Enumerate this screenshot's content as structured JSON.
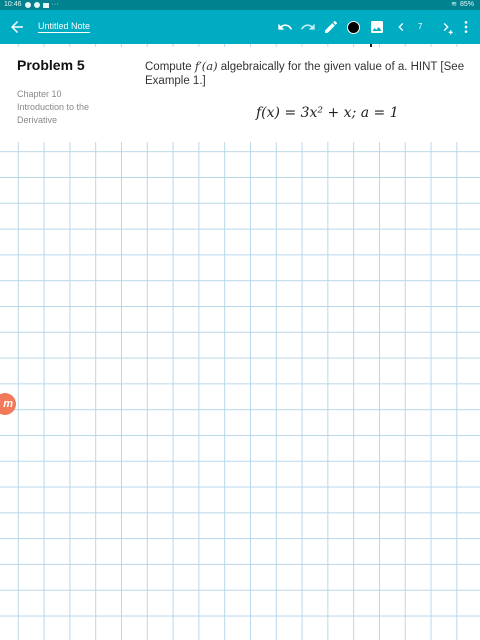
{
  "status": {
    "time": "10:46",
    "battery": "85%"
  },
  "appbar": {
    "note_title": "Untitled Note",
    "page_number": "7"
  },
  "problem": {
    "title": "Problem 5",
    "chapter": "Chapter 10",
    "chapter_name": "Introduction to the Derivative",
    "question_a": "Compute ",
    "question_math": "f′(a)",
    "question_b": " algebraically for the given value of a. HINT [See",
    "question_line2": "Example 1.]",
    "formula": "f(x) = 3x² + x; a = 1"
  },
  "badge": {
    "letter": "m"
  },
  "icons": [
    "arrow-left-icon",
    "undo-icon",
    "redo-icon",
    "pen-icon",
    "color-dot-icon",
    "image-icon",
    "chevron-left-icon",
    "chevron-right-icon",
    "more-vert-icon"
  ]
}
